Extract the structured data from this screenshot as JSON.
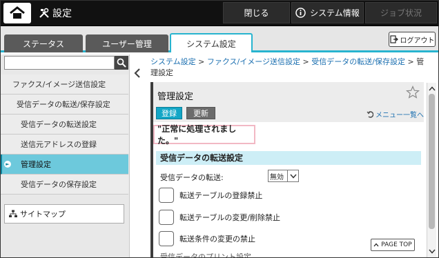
{
  "topbar": {
    "title": "設定",
    "close_label": "閉じる",
    "sysinfo_label": "システム情報",
    "job_label": "ジョブ状況"
  },
  "tabs": [
    {
      "label": "ステータス"
    },
    {
      "label": "ユーザー管理"
    },
    {
      "label": "システム設定"
    }
  ],
  "logout_label": "ログアウト",
  "search": {
    "value": "",
    "placeholder": ""
  },
  "sidebar": {
    "items": [
      {
        "label": "ファクス/イメージ送信設定"
      },
      {
        "label": "受信データの転送/保存設定"
      },
      {
        "label": "受信データの転送設定"
      },
      {
        "label": "送信元アドレスの登録"
      },
      {
        "label": "管理設定"
      },
      {
        "label": "受信データの保存設定"
      }
    ],
    "sitemap_label": "サイトマップ"
  },
  "breadcrumb": {
    "items": [
      "システム設定",
      "ファクス/イメージ送信設定",
      "受信データの転送/保存設定"
    ],
    "current": "管理設定"
  },
  "panel": {
    "title": "管理設定",
    "register_label": "登録",
    "update_label": "更新",
    "menu_list_label": "メニュー一覧へ",
    "message": "\"正常に処理されました。\"",
    "section_title": "受信データの転送設定",
    "transfer_label": "受信データの転送:",
    "transfer_value": "無効",
    "checkboxes": [
      {
        "label": "転送テーブルの登録禁止",
        "checked": false
      },
      {
        "label": "転送テーブルの変更/削除禁止",
        "checked": false
      },
      {
        "label": "転送条件の変更の禁止",
        "checked": false
      }
    ],
    "cut_text": "受信データのプリント設定",
    "pagetop_label": "PAGE TOP"
  },
  "colors": {
    "accent": "#27b4cf",
    "active_menu": "#6dc9dc",
    "register_btn": "#13a6c6",
    "link": "#1b6fb0"
  }
}
